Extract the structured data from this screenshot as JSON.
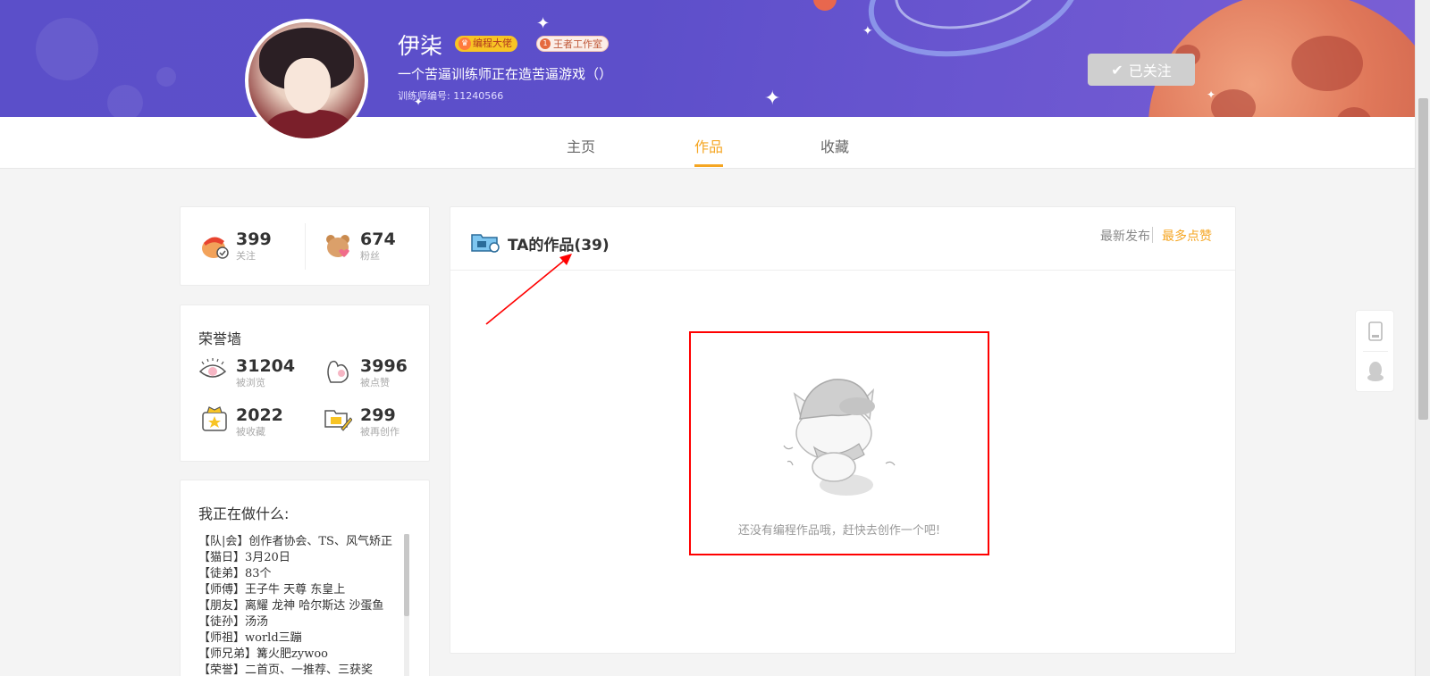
{
  "profile": {
    "name": "伊柒",
    "badge_primary": "编程大佬",
    "badge_secondary": "王者工作室",
    "bio": "一个苦逼训练师正在造苦逼游戏（）",
    "trainer_id": "训练师编号: 11240566",
    "follow_button": "已关注"
  },
  "tabs": [
    {
      "label": "主页",
      "active": false
    },
    {
      "label": "作品",
      "active": true
    },
    {
      "label": "收藏",
      "active": false
    }
  ],
  "social": {
    "following": {
      "value": "399",
      "label": "关注"
    },
    "fans": {
      "value": "674",
      "label": "粉丝"
    }
  },
  "honor": {
    "title": "荣誉墙",
    "views": {
      "value": "31204",
      "label": "被浏览"
    },
    "likes": {
      "value": "3996",
      "label": "被点赞"
    },
    "collected": {
      "value": "2022",
      "label": "被收藏"
    },
    "remixed": {
      "value": "299",
      "label": "被再创作"
    }
  },
  "doing": {
    "title": "我正在做什么:",
    "lines": [
      "【队|会】创作者协会、TS、风气矫正",
      "【猫日】3月20日",
      "【徒弟】83个",
      "【师傅】王子牛 天尊 东皇上",
      "【朋友】离耀 龙神 哈尔斯达 沙蛋鱼",
      "【徒孙】汤汤",
      "【师祖】world三蹦",
      "【师兄弟】篝火肥zywoo",
      "【荣誉】二首页、一推荐、三获奖"
    ]
  },
  "works": {
    "title": "TA的作品(39)",
    "sort_latest": "最新发布",
    "sort_top": "最多点赞",
    "empty_message": "还没有编程作品哦，赶快去创作一个吧!"
  },
  "colors": {
    "accent": "#f5a623",
    "banner": "#5b4fc9",
    "annotation": "#ff0000"
  }
}
